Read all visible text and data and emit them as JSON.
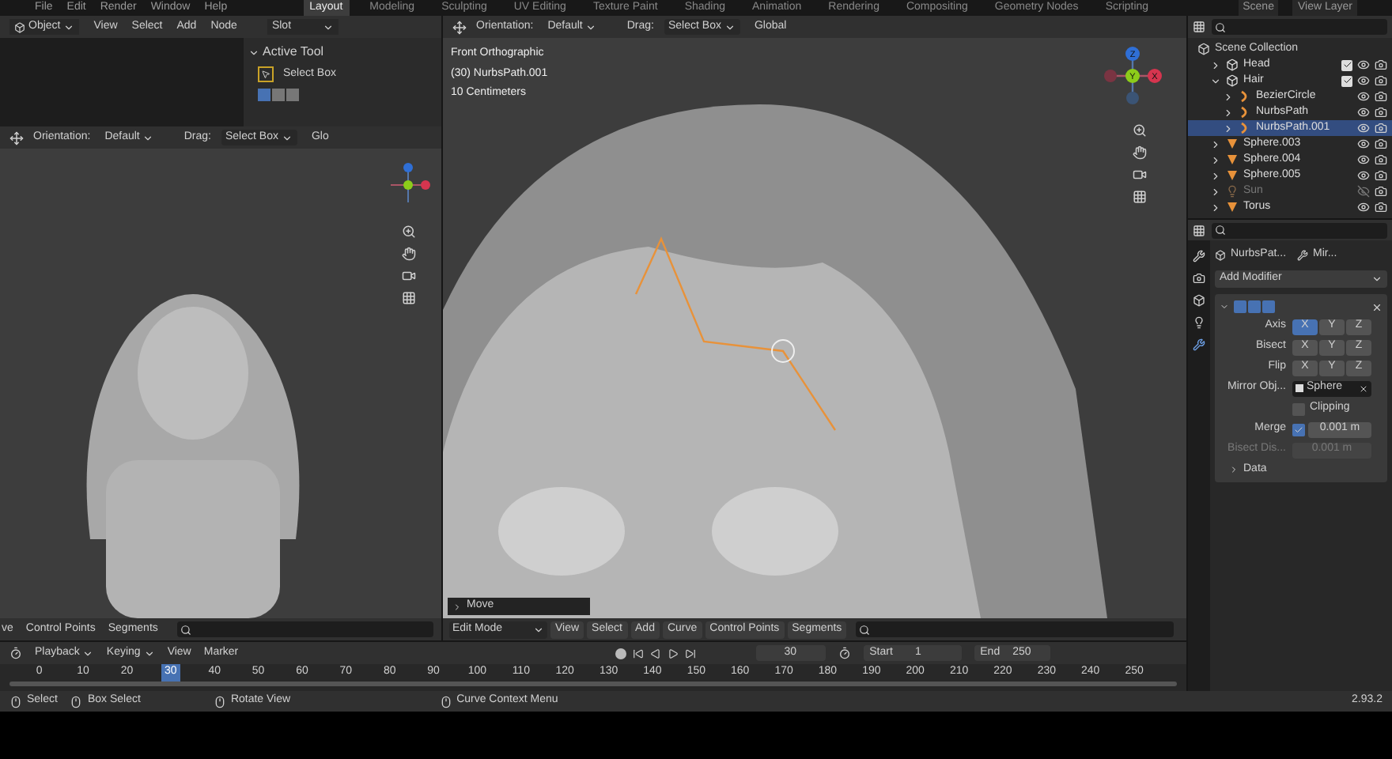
{
  "top_menu": [
    "File",
    "Edit",
    "Render",
    "Window",
    "Help"
  ],
  "workspace_tabs": [
    {
      "label": "Layout",
      "selected": true
    },
    {
      "label": "Modeling",
      "selected": false
    },
    {
      "label": "Sculpting",
      "selected": false
    },
    {
      "label": "UV Editing",
      "selected": false
    },
    {
      "label": "Texture Paint",
      "selected": false
    },
    {
      "label": "Shading",
      "selected": false
    },
    {
      "label": "Animation",
      "selected": false
    },
    {
      "label": "Rendering",
      "selected": false
    },
    {
      "label": "Compositing",
      "selected": false
    },
    {
      "label": "Geometry Nodes",
      "selected": false
    },
    {
      "label": "Scripting",
      "selected": false
    }
  ],
  "scene": "Scene",
  "view_layer": "View Layer",
  "node_editor": {
    "mode": "Object",
    "menus": [
      "View",
      "Select",
      "Add",
      "Node"
    ],
    "slot": "Slot",
    "active_tool": {
      "title": "Active Tool",
      "tool": "Select Box"
    }
  },
  "left_viewport": {
    "orientation_label": "Orientation:",
    "orientation": "Default",
    "drag_label": "Drag:",
    "drag": "Select Box",
    "transform": "Glo",
    "footer_menus": [
      "ve",
      "Control Points",
      "Segments"
    ]
  },
  "main_viewport": {
    "orientation_label": "Orientation:",
    "orientation": "Default",
    "drag_label": "Drag:",
    "drag": "Select Box",
    "transform": "Global",
    "overlay": [
      "Front Orthographic",
      "(30) NurbsPath.001",
      "10 Centimeters"
    ],
    "gizmo": [
      {
        "label": "Z",
        "color": "#2f6fd6"
      },
      {
        "label": "Y",
        "color": "#8ccc1a"
      },
      {
        "label": "X",
        "color": "#d6354f"
      }
    ],
    "last_operator": "Move",
    "mode": "Edit Mode",
    "menus": [
      "View",
      "Select",
      "Add",
      "Curve",
      "Control Points",
      "Segments"
    ]
  },
  "outliner": {
    "root": "Scene Collection",
    "items": [
      {
        "name": "Head",
        "kind": "collection",
        "expanded": false,
        "checked": true,
        "selected": false,
        "visible": true
      },
      {
        "name": "Hair",
        "kind": "collection",
        "expanded": true,
        "checked": true,
        "selected": false,
        "visible": true,
        "children": [
          {
            "name": "BezierCircle",
            "kind": "curve",
            "expanded": false,
            "selected": false,
            "visible": true
          },
          {
            "name": "NurbsPath",
            "kind": "curve",
            "expanded": false,
            "selected": false,
            "visible": true
          },
          {
            "name": "NurbsPath.001",
            "kind": "curve",
            "expanded": false,
            "selected": true,
            "visible": true
          }
        ]
      },
      {
        "name": "Sphere.003",
        "kind": "mesh",
        "expanded": false,
        "selected": false,
        "visible": true
      },
      {
        "name": "Sphere.004",
        "kind": "mesh",
        "expanded": false,
        "selected": false,
        "visible": true
      },
      {
        "name": "Sphere.005",
        "kind": "mesh",
        "expanded": false,
        "selected": false,
        "visible": true
      },
      {
        "name": "Sun",
        "kind": "light",
        "expanded": false,
        "selected": false,
        "visible": false
      },
      {
        "name": "Torus",
        "kind": "mesh",
        "expanded": false,
        "selected": false,
        "visible": true
      }
    ]
  },
  "properties": {
    "object": "NurbsPat...",
    "modifier": "Mir...",
    "add_modifier": "Add Modifier",
    "display_toggles": [
      {
        "on": true
      },
      {
        "on": true
      },
      {
        "on": true
      }
    ],
    "rows": [
      {
        "kind": "xyz",
        "label": "Axis",
        "disabled": false,
        "options": [
          {
            "label": "X",
            "selected": true
          },
          {
            "label": "Y",
            "selected": false
          },
          {
            "label": "Z",
            "selected": false
          }
        ]
      },
      {
        "kind": "xyz",
        "label": "Bisect",
        "disabled": false,
        "options": [
          {
            "label": "X",
            "selected": false
          },
          {
            "label": "Y",
            "selected": false
          },
          {
            "label": "Z",
            "selected": false
          }
        ]
      },
      {
        "kind": "xyz",
        "label": "Flip",
        "disabled": false,
        "options": [
          {
            "label": "X",
            "selected": false
          },
          {
            "label": "Y",
            "selected": false
          },
          {
            "label": "Z",
            "selected": false
          }
        ]
      },
      {
        "kind": "object",
        "label": "Mirror Obj...",
        "disabled": false,
        "value": "Sphere"
      },
      {
        "kind": "check",
        "label": "Clipping",
        "disabled": false,
        "checked": false
      },
      {
        "kind": "check_value",
        "label": "Merge",
        "disabled": false,
        "checked": true,
        "value": "0.001 m"
      },
      {
        "kind": "value",
        "label": "Bisect Dis...",
        "disabled": true,
        "value": "0.001 m"
      }
    ],
    "subpanel": "Data"
  },
  "timeline": {
    "menus": [
      "Playback",
      "Keying",
      "View",
      "Marker"
    ],
    "current_frame": "30",
    "start_label": "Start",
    "start": "1",
    "end_label": "End",
    "end": "250",
    "ticks": [
      {
        "label": "0",
        "selected": false
      },
      {
        "label": "10",
        "selected": false
      },
      {
        "label": "20",
        "selected": false
      },
      {
        "label": "30",
        "selected": true
      },
      {
        "label": "40",
        "selected": false
      },
      {
        "label": "50",
        "selected": false
      },
      {
        "label": "60",
        "selected": false
      },
      {
        "label": "70",
        "selected": false
      },
      {
        "label": "80",
        "selected": false
      },
      {
        "label": "90",
        "selected": false
      },
      {
        "label": "100",
        "selected": false
      },
      {
        "label": "110",
        "selected": false
      },
      {
        "label": "120",
        "selected": false
      },
      {
        "label": "130",
        "selected": false
      },
      {
        "label": "140",
        "selected": false
      },
      {
        "label": "150",
        "selected": false
      },
      {
        "label": "160",
        "selected": false
      },
      {
        "label": "170",
        "selected": false
      },
      {
        "label": "180",
        "selected": false
      },
      {
        "label": "190",
        "selected": false
      },
      {
        "label": "200",
        "selected": false
      },
      {
        "label": "210",
        "selected": false
      },
      {
        "label": "220",
        "selected": false
      },
      {
        "label": "230",
        "selected": false
      },
      {
        "label": "240",
        "selected": false
      },
      {
        "label": "250",
        "selected": false
      }
    ]
  },
  "status_bar": {
    "items": [
      "Select",
      "Box Select",
      "Rotate View",
      "Curve Context Menu"
    ],
    "version": "2.93.2"
  }
}
